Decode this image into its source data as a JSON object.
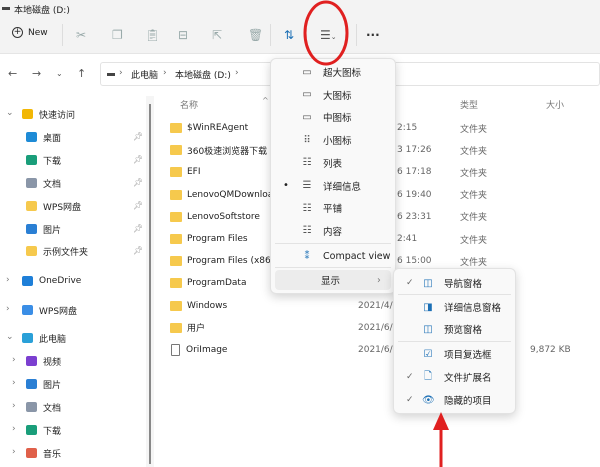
{
  "window": {
    "title": "本地磁盘 (D:)"
  },
  "toolbar": {
    "new_label": "New",
    "more": "···"
  },
  "address": {
    "crumbs": [
      "此电脑",
      "本地磁盘 (D:)"
    ]
  },
  "sidebar": {
    "items": [
      {
        "label": "快速访问",
        "level": 0,
        "expanded": true
      },
      {
        "label": "桌面",
        "level": 1,
        "pinned": true
      },
      {
        "label": "下载",
        "level": 1,
        "pinned": true
      },
      {
        "label": "文档",
        "level": 1,
        "pinned": true
      },
      {
        "label": "WPS网盘",
        "level": 1,
        "pinned": true
      },
      {
        "label": "图片",
        "level": 1,
        "pinned": true
      },
      {
        "label": "示例文件夹",
        "level": 1,
        "pinned": true
      },
      {
        "label": "OneDrive",
        "level": 0
      },
      {
        "label": "WPS网盘",
        "level": 0
      },
      {
        "label": "此电脑",
        "level": 0,
        "expanded": true
      },
      {
        "label": "视频",
        "level": 1
      },
      {
        "label": "图片",
        "level": 1
      },
      {
        "label": "文档",
        "level": 1
      },
      {
        "label": "下载",
        "level": 1
      },
      {
        "label": "音乐",
        "level": 1
      }
    ]
  },
  "columns": {
    "name": "名称",
    "type": "类型",
    "size": "大小"
  },
  "files": [
    {
      "name": "$WinREAgent",
      "date": "2:15",
      "type": "文件夹",
      "size": ""
    },
    {
      "name": "360极速浏览器下载",
      "date": "3 17:26",
      "type": "文件夹",
      "size": ""
    },
    {
      "name": "EFI",
      "date": "6 17:18",
      "type": "文件夹",
      "size": ""
    },
    {
      "name": "LenovoQMDownload",
      "date": "6 19:40",
      "type": "文件夹",
      "size": ""
    },
    {
      "name": "LenovoSoftstore",
      "date": "6 23:31",
      "type": "文件夹",
      "size": ""
    },
    {
      "name": "Program Files",
      "date": "2:41",
      "type": "文件夹",
      "size": ""
    },
    {
      "name": "Program Files (x86)",
      "date": "6 15:00",
      "type": "文件夹",
      "size": ""
    },
    {
      "name": "ProgramData",
      "date": "",
      "type": "",
      "size": ""
    },
    {
      "name": "Windows",
      "date": "2021/4/",
      "type": "",
      "size": ""
    },
    {
      "name": "用户",
      "date": "2021/6/2",
      "type": "",
      "size": ""
    },
    {
      "name": "OriImage",
      "date": "2021/6/2",
      "type": "",
      "size": "9,872 KB"
    }
  ],
  "view_menu": {
    "items": [
      "超大图标",
      "大图标",
      "中图标",
      "小图标",
      "列表",
      "详细信息",
      "平铺",
      "内容"
    ],
    "selected": "详细信息",
    "compact": "Compact view",
    "show": "显示"
  },
  "show_menu": {
    "items": [
      {
        "label": "导航窗格",
        "checked": true
      },
      {
        "label": "详细信息窗格",
        "checked": false
      },
      {
        "label": "预览窗格",
        "checked": false
      },
      {
        "label": "项目复选框",
        "checked": false
      },
      {
        "label": "文件扩展名",
        "checked": true
      },
      {
        "label": "隐藏的项目",
        "checked": true
      }
    ]
  },
  "annotation_color": "#e02020"
}
